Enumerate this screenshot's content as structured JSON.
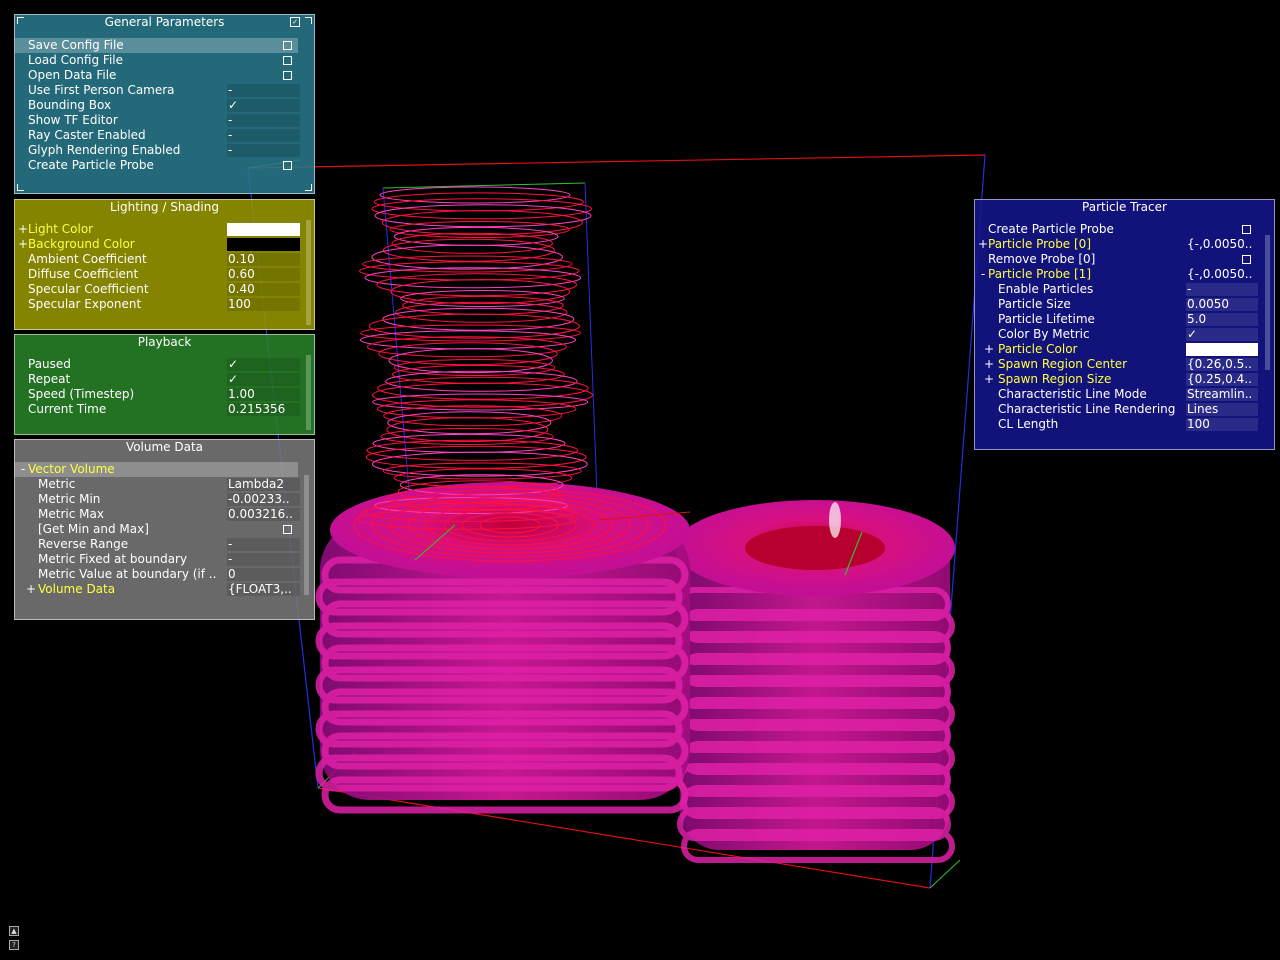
{
  "general": {
    "title": "General Parameters",
    "rows": [
      {
        "label": "Save Config File",
        "type": "button"
      },
      {
        "label": "Load Config File",
        "type": "button"
      },
      {
        "label": "Open Data File",
        "type": "button"
      },
      {
        "label": "Use First Person Camera",
        "type": "bool",
        "value": "-"
      },
      {
        "label": "Bounding Box",
        "type": "bool",
        "value": "✓"
      },
      {
        "label": "Show TF Editor",
        "type": "bool",
        "value": "-"
      },
      {
        "label": "Ray Caster Enabled",
        "type": "bool",
        "value": "-"
      },
      {
        "label": "Glyph Rendering Enabled",
        "type": "bool",
        "value": "-"
      },
      {
        "label": "Create Particle Probe",
        "type": "button"
      }
    ]
  },
  "lighting": {
    "title": "Lighting / Shading",
    "light_color": {
      "label": "Light Color",
      "color": "#ffffff"
    },
    "background_color": {
      "label": "Background Color",
      "color": "#000000"
    },
    "rows": [
      {
        "label": "Ambient Coefficient",
        "value": "0.10"
      },
      {
        "label": "Diffuse Coefficient",
        "value": "0.60"
      },
      {
        "label": "Specular Coefficient",
        "value": "0.40"
      },
      {
        "label": "Specular Exponent",
        "value": "100"
      }
    ]
  },
  "playback": {
    "title": "Playback",
    "rows": [
      {
        "label": "Paused",
        "value": "✓"
      },
      {
        "label": "Repeat",
        "value": "✓"
      },
      {
        "label": "Speed (Timestep)",
        "value": "1.00"
      },
      {
        "label": "Current Time",
        "value": "0.215356"
      }
    ]
  },
  "volume": {
    "title": "Volume Data",
    "group": "Vector Volume",
    "rows": [
      {
        "label": "Metric",
        "value": "Lambda2"
      },
      {
        "label": "Metric Min",
        "value": "-0.00233.."
      },
      {
        "label": "Metric Max",
        "value": "0.003216.."
      },
      {
        "label": "[Get Min and Max]",
        "value": ""
      },
      {
        "label": "Reverse Range",
        "value": "-"
      },
      {
        "label": "Metric Fixed at boundary",
        "value": "-"
      },
      {
        "label": "Metric Value at boundary (if ..",
        "value": "0"
      }
    ],
    "subgroup": {
      "label": "Volume Data",
      "value": "{FLOAT3,.."
    }
  },
  "tracer": {
    "title": "Particle Tracer",
    "create_label": "Create Particle Probe",
    "probe0": {
      "label": "Particle Probe [0]",
      "value": "{-,0.0050.."
    },
    "remove_label": "Remove Probe [0]",
    "probe1": {
      "label": "Particle Probe [1]",
      "value": "{-,0.0050.."
    },
    "rows": [
      {
        "label": "Enable Particles",
        "value": "-"
      },
      {
        "label": "Particle Size",
        "value": "0.0050"
      },
      {
        "label": "Particle Lifetime",
        "value": "5.0"
      },
      {
        "label": "Color By Metric",
        "value": "✓"
      }
    ],
    "particle_color": {
      "label": "Particle Color",
      "color": "#ffffff"
    },
    "spawn_center": {
      "label": "Spawn Region Center",
      "value": "{0.26,0.5.."
    },
    "spawn_size": {
      "label": "Spawn Region Size",
      "value": "{0.25,0.4.."
    },
    "rows2": [
      {
        "label": "Characteristic Line Mode",
        "value": "Streamlin.."
      },
      {
        "label": "Characteristic Line Rendering",
        "value": "Lines"
      },
      {
        "label": "CL Length",
        "value": "100"
      }
    ]
  },
  "colors": {
    "accent_yellow": "#ffff40",
    "general_bg": "#28788a",
    "lighting_bg": "#969600",
    "playback_bg": "#288228",
    "volume_bg": "#787878",
    "tracer_bg": "#14148c",
    "vortex": "#e0108a",
    "streamline": "#ff1040"
  }
}
